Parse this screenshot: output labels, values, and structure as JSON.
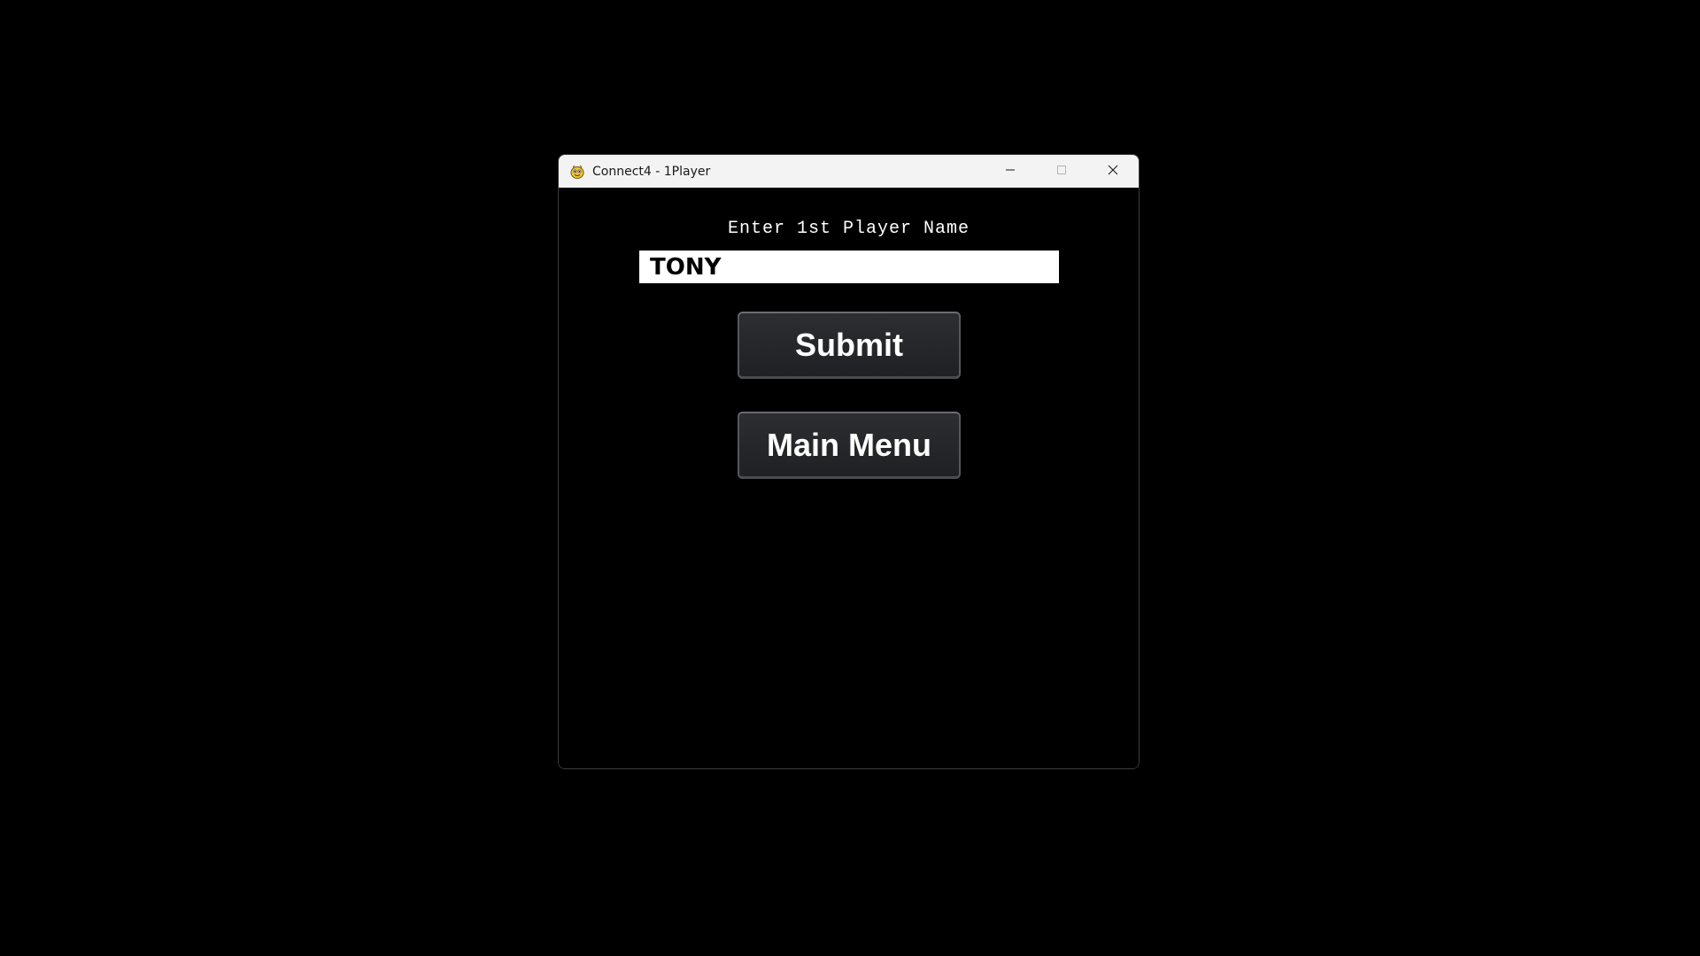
{
  "window": {
    "title": "Connect4 - 1Player",
    "app_icon": "pygame-snake-icon",
    "controls": {
      "minimize_icon": "minimize-icon",
      "maximize_icon": "maximize-icon",
      "close_icon": "close-icon"
    }
  },
  "form": {
    "prompt": "Enter 1st Player Name",
    "name_value": "TONY",
    "submit_label": "Submit",
    "main_menu_label": "Main Menu"
  },
  "colors": {
    "background": "#000000",
    "titlebar": "#f3f3f3",
    "button": "#26282b",
    "input": "#ffffff"
  }
}
